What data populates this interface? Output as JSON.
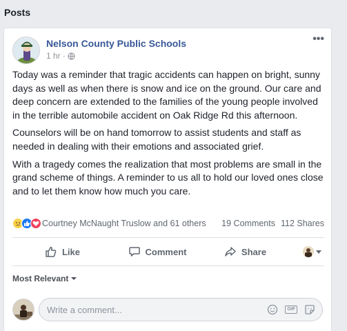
{
  "section": {
    "title": "Posts"
  },
  "post": {
    "author": "Nelson County Public Schools",
    "time": "1 hr",
    "separator": "·",
    "more_label": "•••",
    "paragraphs": [
      "Today was a reminder that tragic accidents can happen on bright, sunny days as well as when there is snow and ice on the ground. Our care and deep concern are extended to the families of the young people involved in the terrible automobile accident on Oak Ridge Rd this afternoon.",
      "Counselors will be on hand tomorrow to assist students and staff as needed in dealing with their emotions and associated grief.",
      "With a tragedy comes the realization that most problems are small in the grand scheme of things. A reminder to us all to hold our loved ones close and to let them know how much you care."
    ]
  },
  "reactions": {
    "icons": [
      "sad-react-icon",
      "like-react-icon",
      "love-react-icon"
    ],
    "names": "Courtney McNaught Truslow and 61 others",
    "comments": "19 Comments",
    "shares": "112 Shares"
  },
  "actions": {
    "like_label": "Like",
    "comment_label": "Comment",
    "share_label": "Share"
  },
  "comments": {
    "sort_label": "Most Relevant",
    "input_placeholder": "Write a comment...",
    "gif_label": "GIF"
  },
  "colors": {
    "link": "#385898",
    "like_blue": "#1877f2",
    "love_red": "#f0425c",
    "sad_yellow": "#f7d04c",
    "muted": "#606770"
  }
}
